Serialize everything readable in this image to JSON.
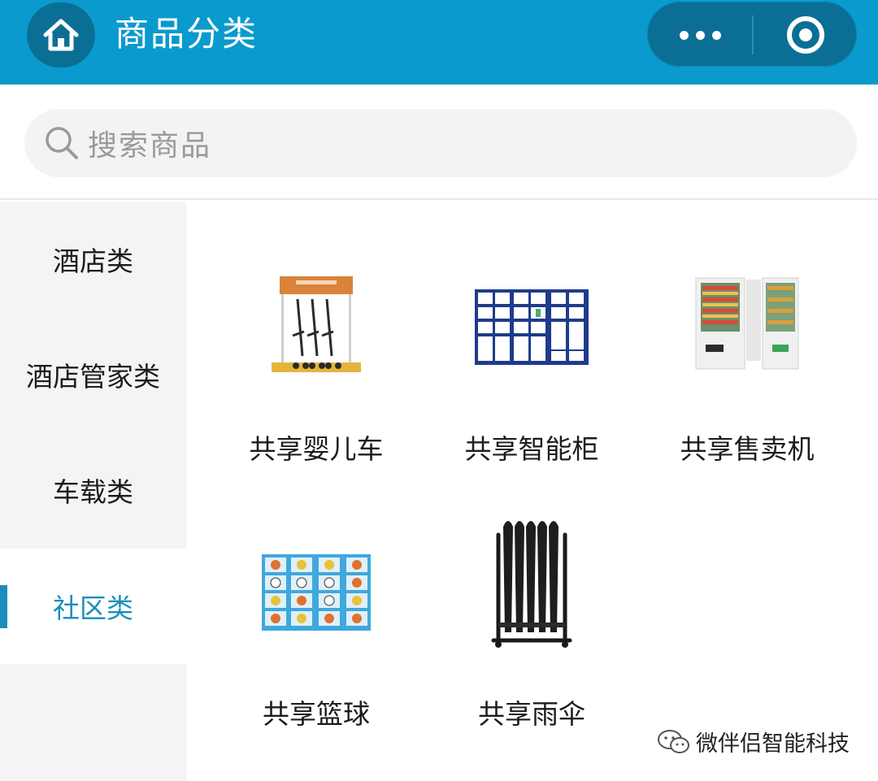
{
  "header": {
    "title": "商品分类",
    "home_icon": "home-icon",
    "more_icon": "more-dots-icon",
    "close_icon": "target-circle-icon",
    "background_color": "#0a9acd"
  },
  "search": {
    "placeholder": "搜索商品",
    "icon": "search-icon"
  },
  "sidebar": {
    "items": [
      {
        "label": "酒店类",
        "active": false
      },
      {
        "label": "酒店管家类",
        "active": false
      },
      {
        "label": "车载类",
        "active": false
      },
      {
        "label": "社区类",
        "active": true
      }
    ],
    "active_color": "#1a8dbc"
  },
  "products": [
    {
      "label": "共享婴儿车",
      "icon": "stroller-rack-image"
    },
    {
      "label": "共享智能柜",
      "icon": "smart-locker-image"
    },
    {
      "label": "共享售卖机",
      "icon": "vending-machine-image"
    },
    {
      "label": "共享篮球",
      "icon": "basketball-locker-image"
    },
    {
      "label": "共享雨伞",
      "icon": "umbrella-rack-image"
    }
  ],
  "watermark": {
    "text": "微伴侣智能科技",
    "icon": "wechat-icon"
  }
}
